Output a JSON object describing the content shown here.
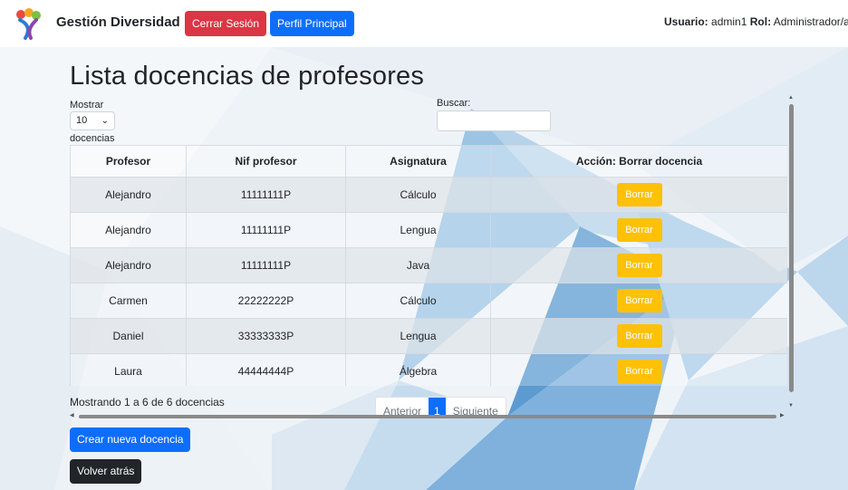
{
  "navbar": {
    "brand": "Gestión Diversidad",
    "logout_label": "Cerrar Sesión",
    "profile_label": "Perfil Principal",
    "user_label": "Usuario:",
    "user_value": "admin1",
    "role_label": "Rol:",
    "role_value": "Administrador/a"
  },
  "page": {
    "title": "Lista docencias de profesores",
    "show_label": "Mostrar",
    "show_value": "10",
    "show_suffix": "docencias",
    "search_label": "Buscar:",
    "search_value": ""
  },
  "table": {
    "headers": [
      "Profesor",
      "Nif profesor",
      "Asignatura",
      "Acción: Borrar docencia"
    ],
    "rows": [
      {
        "profesor": "Alejandro",
        "nif": "11111111P",
        "asignatura": "Cálculo",
        "action": "Borrar"
      },
      {
        "profesor": "Alejandro",
        "nif": "11111111P",
        "asignatura": "Lengua",
        "action": "Borrar"
      },
      {
        "profesor": "Alejandro",
        "nif": "11111111P",
        "asignatura": "Java",
        "action": "Borrar"
      },
      {
        "profesor": "Carmen",
        "nif": "22222222P",
        "asignatura": "Cálculo",
        "action": "Borrar"
      },
      {
        "profesor": "Daniel",
        "nif": "33333333P",
        "asignatura": "Lengua",
        "action": "Borrar"
      },
      {
        "profesor": "Laura",
        "nif": "44444444P",
        "asignatura": "Álgebra",
        "action": "Borrar"
      }
    ]
  },
  "footer": {
    "info": "Mostrando 1 a 6 de 6 docencias",
    "prev": "Anterior",
    "page": "1",
    "next": "Siguiente",
    "create_label": "Crear nueva docencia",
    "back_label": "Volver atrás"
  },
  "colors": {
    "danger": "#dc3545",
    "primary": "#0d6efd",
    "warning": "#ffc107",
    "dark": "#212529"
  }
}
